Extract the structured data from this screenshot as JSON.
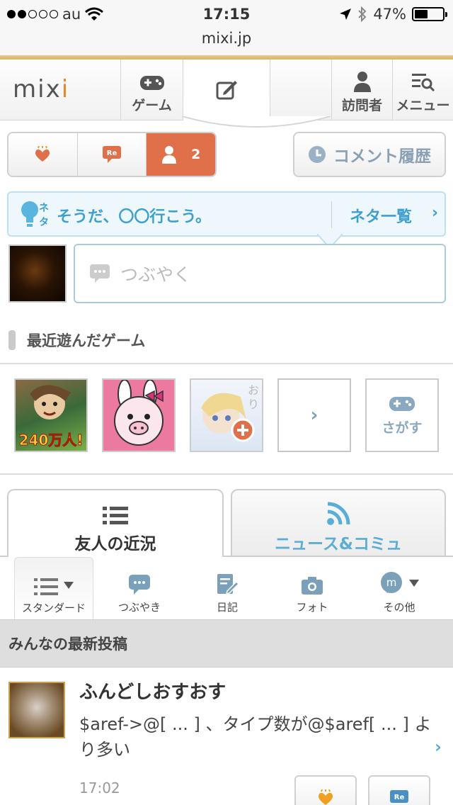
{
  "status_bar": {
    "carrier": "au",
    "time": "17:15",
    "battery": "47%",
    "signal_bars": 2,
    "signal_total": 5,
    "battery_level": 0.47
  },
  "browser": {
    "url": "mixi.jp"
  },
  "nav": {
    "logo": "mixi",
    "game_label": "ゲーム",
    "visitors_label": "訪問者",
    "menu_label": "メニュー"
  },
  "reactions": {
    "like_icon": "heart-hand-icon",
    "comment_icon": "re-bubble-icon",
    "user_count": "2",
    "history_label": "コメント履歴"
  },
  "neta": {
    "badge": "ネタ",
    "suggestion": "そうだ、〇〇行こう。",
    "list_label": "ネタ一覧",
    "chevron": "›"
  },
  "post_box": {
    "placeholder": "つぶやく"
  },
  "games": {
    "section_title": "最近遊んだゲーム",
    "g1_badge": "240万人!",
    "more_chevron": "›",
    "search_label": "さがす",
    "g3_deco": "おり",
    "g3_add": "+"
  },
  "feed_tabs": {
    "friends_label": "友人の近況",
    "news_label": "ニュース&コミュ"
  },
  "filters": [
    {
      "label": "スタンダード",
      "icon": "list-icon"
    },
    {
      "label": "つぶやき",
      "icon": "speech-bubble-icon"
    },
    {
      "label": "日記",
      "icon": "diary-icon"
    },
    {
      "label": "フォト",
      "icon": "camera-icon"
    },
    {
      "label": "その他",
      "icon": "m-circle-icon"
    }
  ],
  "latest": {
    "title": "みんなの最新投稿"
  },
  "post": {
    "name": "ふんどしおすおす",
    "body": "$aref->@[ ... ] 、タイプ数が@$aref[ ... ] より多い",
    "time": "17:02",
    "chevron": "›"
  },
  "colors": {
    "accent_orange": "#e0704a",
    "link_blue": "#3fa0d0",
    "gold": "#d9b46a"
  }
}
